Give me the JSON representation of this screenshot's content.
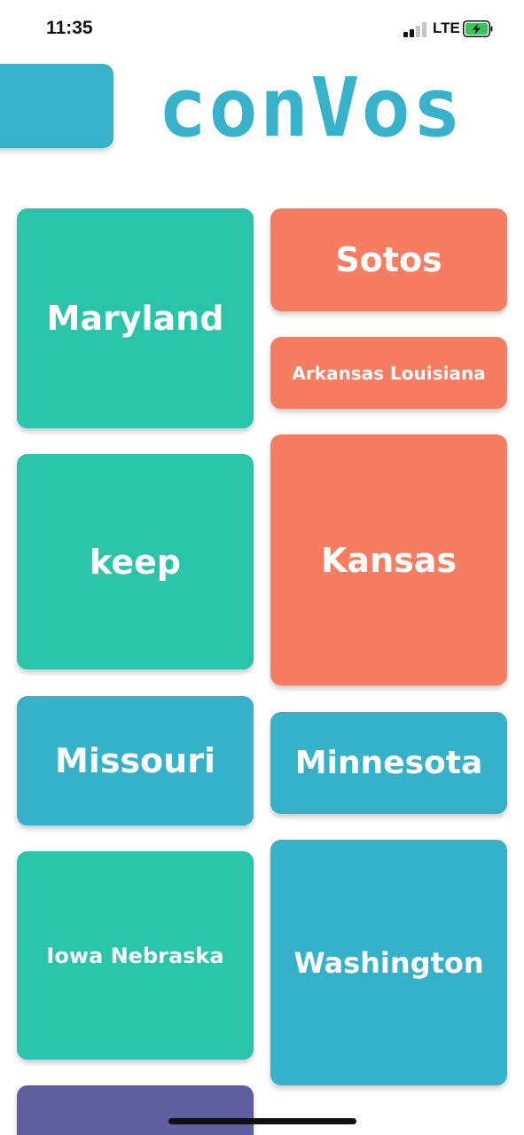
{
  "status_bar": {
    "time": "11:35",
    "network": "LTE"
  },
  "header": {
    "title": "conVos"
  },
  "tiles": [
    {
      "label": "Maryland"
    },
    {
      "label": "Sotos"
    },
    {
      "label": "Arkansas Louisiana"
    },
    {
      "label": "keep"
    },
    {
      "label": "Kansas"
    },
    {
      "label": "Missouri"
    },
    {
      "label": "Minnesota"
    },
    {
      "label": "Iowa Nebraska"
    },
    {
      "label": "Washington"
    }
  ],
  "colors": {
    "accent": "#37b2ca",
    "green": "#29c4a9",
    "orange": "#f67d61",
    "blue": "#35b1ca",
    "purple": "#5f5f9f"
  }
}
